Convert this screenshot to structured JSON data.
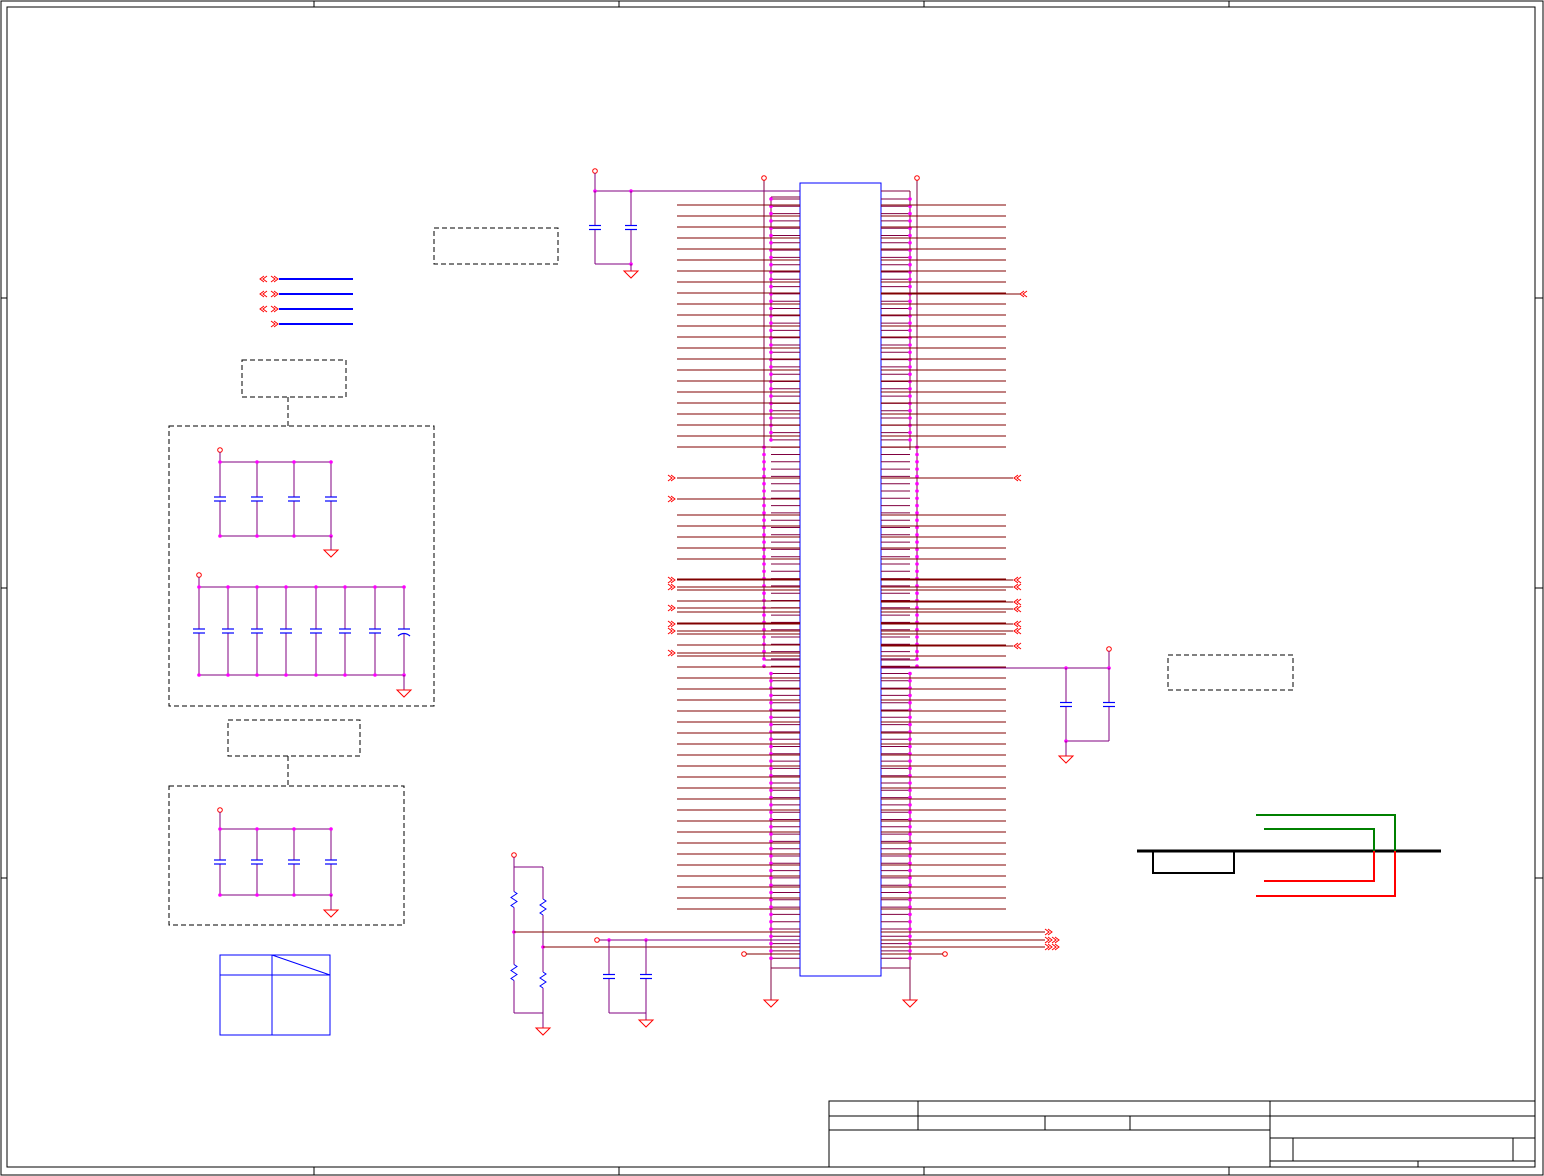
{
  "title_block": {
    "fields": []
  },
  "colors": {
    "border": "#000000",
    "net": "#800000",
    "pin_stub": "#800040",
    "component": "#800080",
    "junction": "#ff00ff",
    "port": "#ff0000",
    "chip_body": "#0000ff",
    "bus": "#0000ff",
    "ground": "#ff0000",
    "note_box": "#000000",
    "diff_pair_green": "#008000",
    "diff_pair_red": "#ff0000",
    "plane": "#000000"
  },
  "schematic": {
    "chip_count": 1,
    "decoupling_groups": 3
  }
}
